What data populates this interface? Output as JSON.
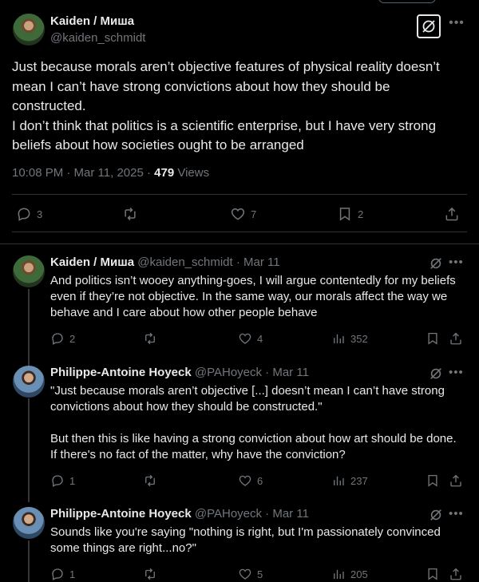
{
  "main": {
    "author_name": "Kaiden / Миша",
    "handle": "@kaiden_schmidt",
    "paragraphs": [
      "Just because morals aren’t objective features of physical reality doesn’t mean I can’t have strong convictions about how they should be constructed.",
      "I don’t think that politics is a scientific enterprise, but I have very strong beliefs about how societies ought to be arranged"
    ],
    "timestamp": "10:08 PM · Mar 11, 2025 · ",
    "views_count": "479",
    "views_label": " Views",
    "replies": "3",
    "likes": "7",
    "bookmarks": "2"
  },
  "replies": [
    {
      "author_name": "Kaiden / Миша",
      "meta": " @kaiden_schmidt · Mar 11",
      "paragraphs": [
        "And politics isn’t wooey anything-goes, I will argue contentedly for my beliefs even if they’re not objective. In the same way, our morals affect the way we behave and I care about how other people behave"
      ],
      "replies": "2",
      "likes": "4",
      "views": "352"
    },
    {
      "author_name": "Philippe-Antoine Hoyeck",
      "meta": " @PAHoyeck · Mar 11",
      "paragraphs": [
        "\"Just because morals aren’t objective [...] doesn’t mean I can’t have strong convictions about how they should be constructed.\"",
        "But then this is like having a strong conviction about how art should be done. If there's no fact of the matter, why have the conviction?"
      ],
      "replies": "1",
      "likes": "6",
      "views": "237"
    },
    {
      "author_name": "Philippe-Antoine Hoyeck",
      "meta": " @PAHoyeck · Mar 11",
      "paragraphs": [
        "Sounds like you're saying \"nothing is right, but I'm passionately convinced some things are right...no?\""
      ],
      "replies": "1",
      "likes": "5",
      "views": "205"
    }
  ],
  "icons": {
    "reply": "reply-icon",
    "repost": "repost-icon",
    "like": "heart-icon",
    "views": "views-icon",
    "bookmark": "bookmark-icon",
    "share": "share-icon",
    "grok": "grok-icon",
    "more": "more-icon"
  },
  "colors": {
    "background": "#000000",
    "text": "#e7e9ea",
    "secondary": "#71767b",
    "divider": "#2f3336"
  }
}
